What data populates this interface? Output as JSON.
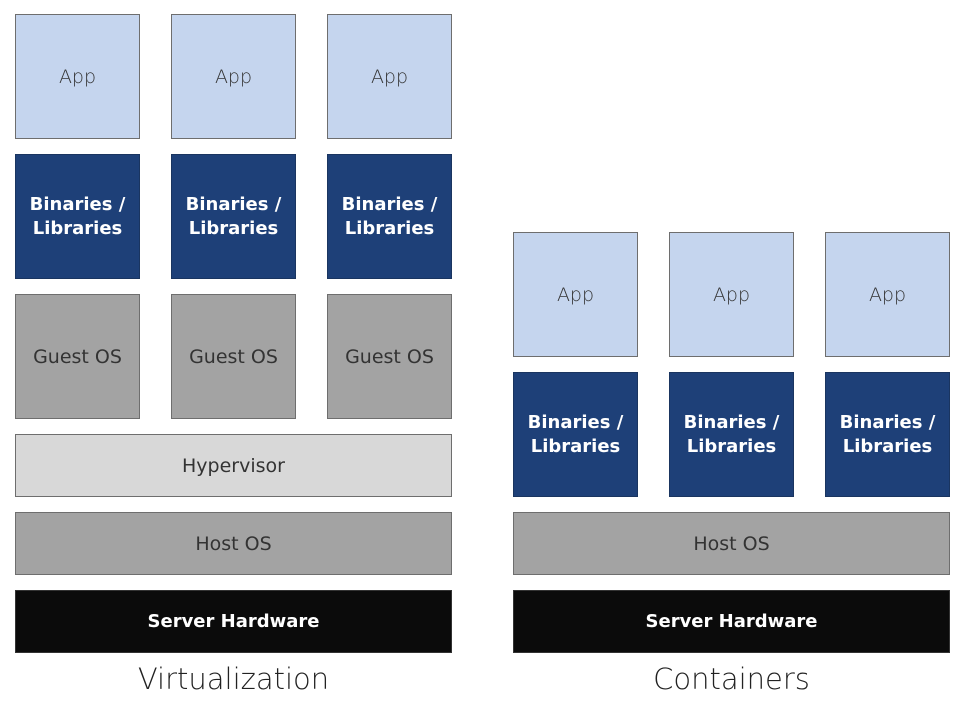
{
  "virtualization": {
    "title": "Virtualization",
    "apps": [
      "App",
      "App",
      "App"
    ],
    "binaries": [
      "Binaries /\nLibraries",
      "Binaries /\nLibraries",
      "Binaries /\nLibraries"
    ],
    "guest_os": [
      "Guest OS",
      "Guest OS",
      "Guest OS"
    ],
    "hypervisor": "Hypervisor",
    "host_os": "Host OS",
    "hardware": "Server Hardware"
  },
  "containers": {
    "title": "Containers",
    "apps": [
      "App",
      "App",
      "App"
    ],
    "binaries": [
      "Binaries /\nLibraries",
      "Binaries /\nLibraries",
      "Binaries /\nLibraries"
    ],
    "host_os": "Host OS",
    "hardware": "Server Hardware"
  },
  "colors": {
    "app": "#c5d5ee",
    "binaries": "#1e4078",
    "guest_os": "#a3a3a3",
    "hypervisor": "#d8d8d8",
    "host_os": "#a3a3a3",
    "hardware": "#0b0b0b"
  }
}
